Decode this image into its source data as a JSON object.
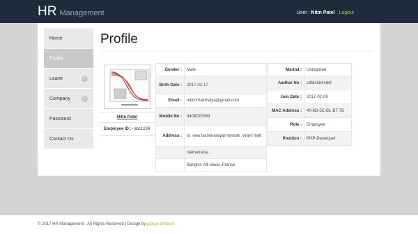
{
  "header": {
    "brand_main": "HR",
    "brand_sub": "Management",
    "user_label": "User :",
    "user_name": "Nitin Patel",
    "logout": "Logout"
  },
  "sidebar": {
    "items": [
      {
        "label": "Home",
        "active": false
      },
      {
        "label": "Profile",
        "active": true
      },
      {
        "label": "Leave",
        "active": false,
        "chevron": true
      },
      {
        "label": "Company",
        "active": false,
        "chevron": true
      },
      {
        "label": "Password",
        "active": false
      },
      {
        "label": "Contact Us",
        "active": false
      }
    ]
  },
  "page": {
    "title": "Profile"
  },
  "employee": {
    "name": "Nitin Patel",
    "id_label": "Employee ID :-",
    "id_value": "abc1234"
  },
  "details_left": [
    {
      "label": "Gender :",
      "value": "Male"
    },
    {
      "label": "Birth Date :",
      "value": "2017-02-17"
    },
    {
      "label": "Email :",
      "value": "nitinchhabhaiya@gmail.com"
    },
    {
      "label": "Mobile No :",
      "value": "9408020069"
    },
    {
      "label": "Address :",
      "value": "nr. new laxminarayan temple ,virani moti ,"
    },
    {
      "label": "",
      "value": "nakhatrana , ."
    },
    {
      "label": "",
      "value": "Banglor, Alli towar, France"
    }
  ],
  "details_right": [
    {
      "label": "Marital :",
      "value": "Unmarried"
    },
    {
      "label": "Aadhar No :",
      "value": "sdfds5644dsf"
    },
    {
      "label": "Join Date :",
      "value": "2017-02-09"
    },
    {
      "label": "MAC Address :",
      "value": "40-8D-5C-B1-B7-7D"
    },
    {
      "label": "Role :",
      "value": "Employee"
    },
    {
      "label": "Position :",
      "value": "PHP-Developer"
    }
  ],
  "footer": {
    "text": "© 2017 HR Management . All Rights Reserved | Design by",
    "link": "jupsys infotech"
  },
  "colors": {
    "topbar": "#1e2b3a",
    "accent_link": "#b7c84a",
    "sidebar_active": "#c9c9c9"
  }
}
